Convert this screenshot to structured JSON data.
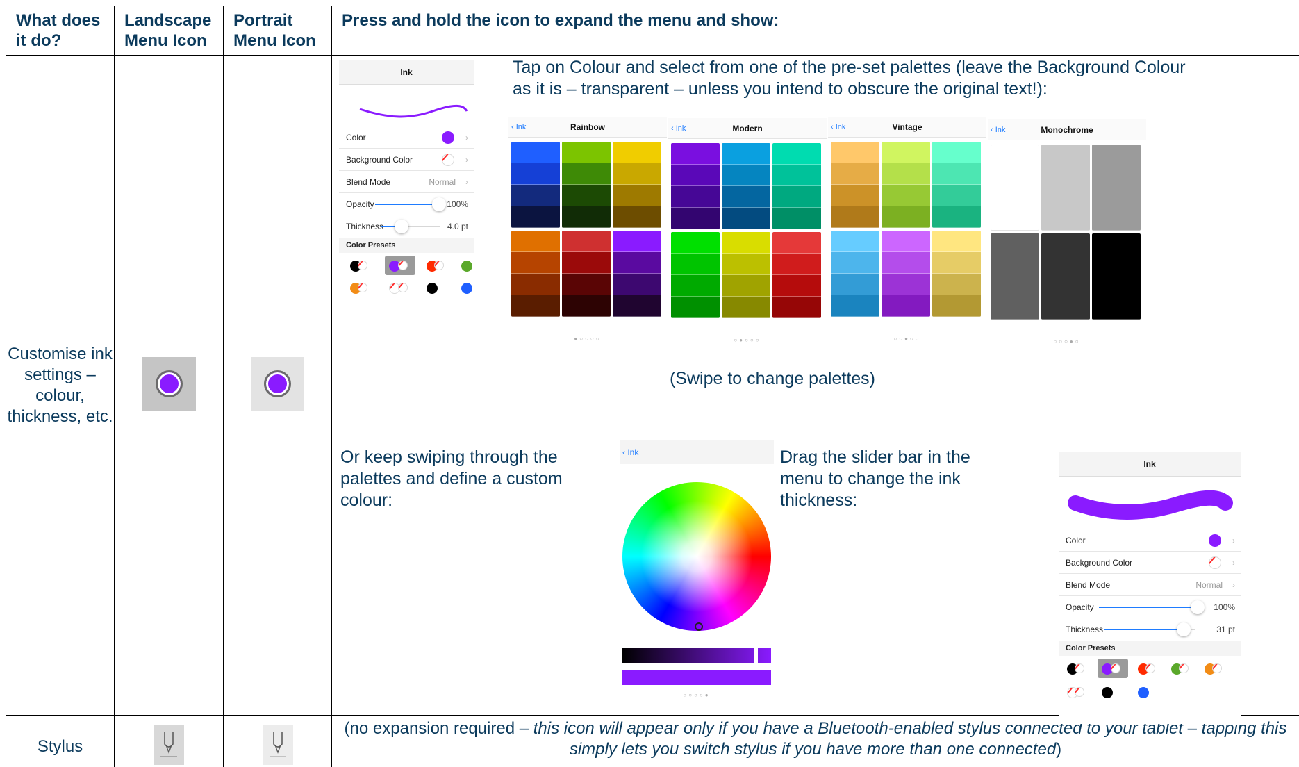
{
  "headers": {
    "what": "What does it do?",
    "landscape": "Landscape Menu Icon",
    "portrait": "Portrait Menu Icon",
    "press": "Press and hold the icon to expand the menu and show:"
  },
  "row_ink": {
    "description": "Customise ink settings – colour, thickness, etc.",
    "tap_text": "Tap on Colour and select from one of the pre-set palettes (leave the Background Colour as it is – transparent – unless you intend to obscure the original text!):",
    "swipe_caption": "(Swipe to change palettes)",
    "custom_text": "Or keep swiping through the palettes and define a custom colour:",
    "drag_text": "Drag the slider bar in the menu to change the ink thickness:",
    "icon": "ink-color-icon"
  },
  "panel1": {
    "title": "Ink",
    "color_label": "Color",
    "bg_label": "Background Color",
    "blend_label": "Blend Mode",
    "blend_value": "Normal",
    "opacity_label": "Opacity",
    "opacity_value": "100%",
    "thickness_label": "Thickness",
    "thickness_value": "4.0 pt",
    "presets_label": "Color Presets",
    "ink_color": "#8a1bff"
  },
  "panel2": {
    "title": "Ink",
    "color_label": "Color",
    "bg_label": "Background Color",
    "blend_label": "Blend Mode",
    "blend_value": "Normal",
    "opacity_label": "Opacity",
    "opacity_value": "100%",
    "thickness_label": "Thickness",
    "thickness_value": "31 pt",
    "presets_label": "Color Presets"
  },
  "palettes": [
    {
      "back": "Ink",
      "name": "Rainbow",
      "dots": "●○○○○",
      "columns": [
        [
          "#1f5fff",
          "#1540d6",
          "#132a7d",
          "#0b1440"
        ],
        [
          "#7cc400",
          "#3e8a06",
          "#1c4a04",
          "#112c06"
        ],
        [
          "#f0cd00",
          "#c9a800",
          "#9e7a00",
          "#6d4d00"
        ],
        [
          "#e07000",
          "#b64400",
          "#8a2c00",
          "#5a1d00"
        ],
        [
          "#cf3030",
          "#9b0a0a",
          "#5a0505",
          "#2d0303"
        ],
        [
          "#8a1bff",
          "#5a0aa0",
          "#3d0870",
          "#200530"
        ]
      ]
    },
    {
      "back": "Ink",
      "name": "Modern",
      "dots": "○●○○○",
      "columns": [
        [
          "#7a0fe0",
          "#5a08b8",
          "#460796",
          "#330570"
        ],
        [
          "#0aa0e0",
          "#0585c0",
          "#0466a0",
          "#034b80"
        ],
        [
          "#00dcb0",
          "#00c29a",
          "#00a980",
          "#008f66"
        ],
        [
          "#00e000",
          "#00c400",
          "#00aa00",
          "#009000"
        ],
        [
          "#d9dd00",
          "#bcc000",
          "#a0a300",
          "#878900"
        ],
        [
          "#e53939",
          "#d01c1c",
          "#b50c0c",
          "#960606"
        ]
      ]
    },
    {
      "back": "Ink",
      "name": "Vintage",
      "dots": "○○●○○",
      "columns": [
        [
          "#ffc86a",
          "#e6ac46",
          "#cc9228",
          "#b07a1a"
        ],
        [
          "#d0f560",
          "#b4e04a",
          "#97c934",
          "#7cb022"
        ],
        [
          "#66ffcc",
          "#4de6b2",
          "#33cc99",
          "#1ab380"
        ],
        [
          "#66ccff",
          "#4db5ec",
          "#339cd6",
          "#1a84bf"
        ],
        [
          "#cc66ff",
          "#b44deb",
          "#9c33d6",
          "#831ac0"
        ],
        [
          "#ffe680",
          "#e6cc66",
          "#ccb34d",
          "#b39933"
        ]
      ]
    },
    {
      "back": "Ink",
      "name": "Monochrome",
      "dots": "○○○●○",
      "columns": [
        [
          "#ffffff"
        ],
        [
          "#c8c8c8"
        ],
        [
          "#9b9b9b"
        ],
        [
          "#606060"
        ],
        [
          "#333333"
        ],
        [
          "#000000"
        ]
      ]
    }
  ],
  "custom_picker": {
    "back": "Ink",
    "dots": "○○○○●"
  },
  "row_stylus": {
    "description": "Stylus",
    "text_a": "(no expansion required – ",
    "text_b": "this icon will appear only if you have a Bluetooth-enabled stylus connected to your tablet",
    "text_c": " – ",
    "text_d": "tapping this simply lets you switch stylus if you have more than one connected",
    "text_e": ")",
    "icon": "stylus-pen-icon"
  }
}
